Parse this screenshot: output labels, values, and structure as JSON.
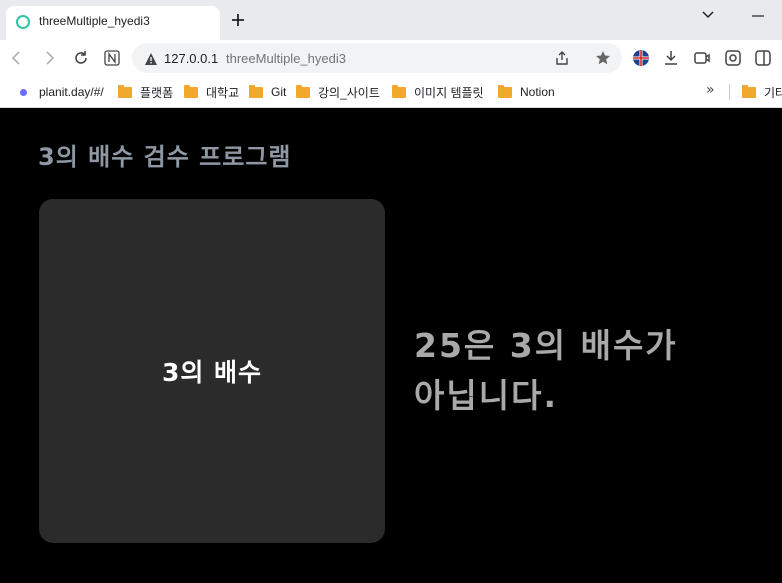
{
  "browser": {
    "tab": {
      "title": "threeMultiple_hyedi3"
    },
    "url": {
      "host": "127.0.0.1",
      "path": "threeMultiple_hyedi3"
    },
    "bookmarks": [
      {
        "label": "planit.day/#/",
        "icon": "dot-icon"
      },
      {
        "label": "플랫폼",
        "icon": "folder-icon"
      },
      {
        "label": "대학교",
        "icon": "folder-icon"
      },
      {
        "label": "Git",
        "icon": "folder-icon"
      },
      {
        "label": "강의_사이트",
        "icon": "folder-icon"
      },
      {
        "label": "이미지 템플릿",
        "icon": "folder-icon"
      },
      {
        "label": "Notion",
        "icon": "folder-icon"
      }
    ],
    "overflow_label": "»",
    "extra_folder": "기타"
  },
  "page": {
    "title": "3의 배수 검수 프로그램",
    "card_label": "3의 배수",
    "result_text": "25은 3의 배수가 아닙니다.",
    "colors": {
      "background": "#000000",
      "card": "#2b2b2b",
      "title": "#8e98a4",
      "result": "#a9a9a9"
    }
  }
}
